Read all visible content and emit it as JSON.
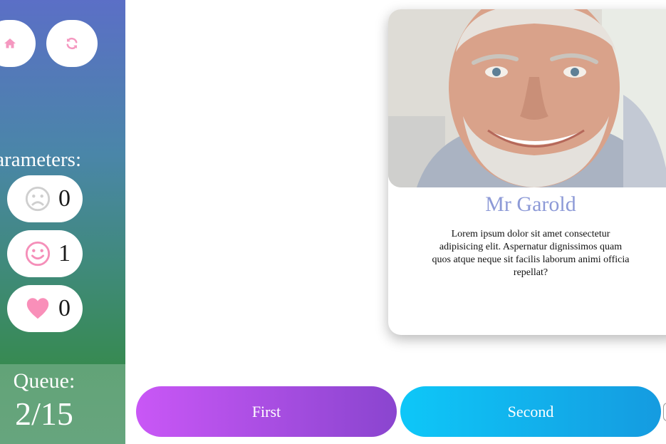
{
  "sidebar": {
    "home_icon": "home-icon",
    "refresh_icon": "refresh-icon",
    "params_label": "Parameters:",
    "params": [
      {
        "icon": "sad-face-icon",
        "value": "0",
        "color": "#cfcfcf"
      },
      {
        "icon": "happy-face-icon",
        "value": "1",
        "color": "#f58fb9"
      },
      {
        "icon": "heart-icon",
        "value": "0",
        "color": "#f98fb9"
      }
    ],
    "queue_label": "Queue:",
    "queue_value": "2/15"
  },
  "card": {
    "name": "Mr Garold",
    "description": "Lorem ipsum dolor sit amet consectetur adipisicing elit. Aspernatur dignissimos quam quos atque neque sit facilis laborum animi officia repellat?"
  },
  "choices": {
    "first_label": "First",
    "second_label": "Second"
  },
  "colors": {
    "accent_pink": "#f598c0",
    "name_color": "#8d9ad7",
    "first_gradient": [
      "#c957f6",
      "#8a45cf"
    ],
    "second_gradient": [
      "#0ec7f8",
      "#159be0"
    ]
  }
}
